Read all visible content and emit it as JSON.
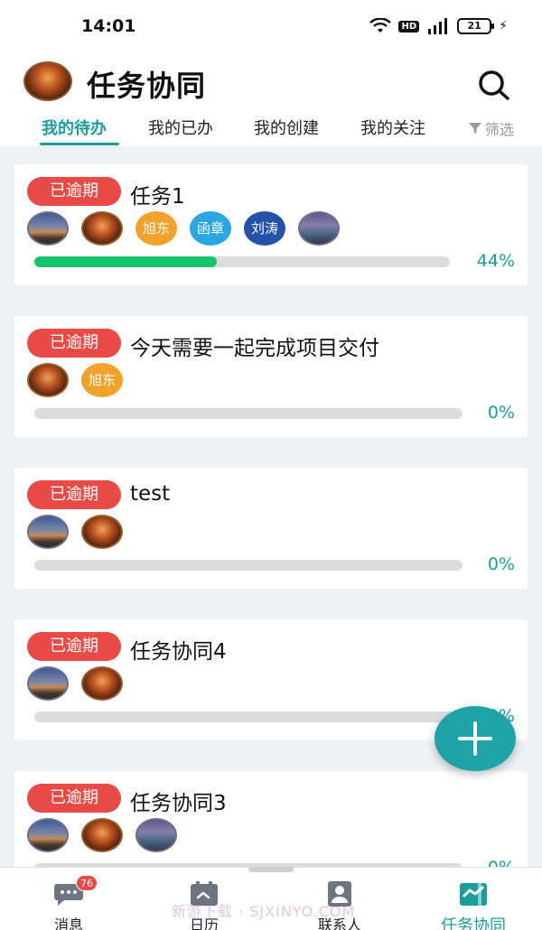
{
  "status_bar": {
    "time": "14:01",
    "hd_label": "HD",
    "battery": "21"
  },
  "header": {
    "title": "任务协同",
    "tabs": [
      {
        "label": "我的待办",
        "active": true
      },
      {
        "label": "我的已办",
        "active": false
      },
      {
        "label": "我的创建",
        "active": false
      },
      {
        "label": "我的关注",
        "active": false
      }
    ],
    "filter_label": "筛选"
  },
  "tasks": [
    {
      "status": "已逾期",
      "title": "任务1",
      "progress_label": "44%",
      "progress": 0.44,
      "assignees": [
        {
          "type": "photo",
          "style": "photo-a"
        },
        {
          "type": "photo",
          "style": "photo-b"
        },
        {
          "type": "text",
          "name": "旭东",
          "color": "#f0a22a"
        },
        {
          "type": "text",
          "name": "函章",
          "color": "#2aa7e0"
        },
        {
          "type": "text",
          "name": "刘涛",
          "color": "#2452a8"
        },
        {
          "type": "photo",
          "style": "photo-c"
        }
      ]
    },
    {
      "status": "已逾期",
      "title": "今天需要一起完成项目交付",
      "progress_label": "0%",
      "progress": 0,
      "assignees": [
        {
          "type": "photo",
          "style": "photo-b"
        },
        {
          "type": "text",
          "name": "旭东",
          "color": "#f0a22a"
        }
      ]
    },
    {
      "status": "已逾期",
      "title": "test",
      "progress_label": "0%",
      "progress": 0,
      "assignees": [
        {
          "type": "photo",
          "style": "photo-a"
        },
        {
          "type": "photo",
          "style": "photo-b"
        }
      ]
    },
    {
      "status": "已逾期",
      "title": "任务协同4",
      "progress_label": "0%",
      "progress": 0,
      "assignees": [
        {
          "type": "photo",
          "style": "photo-a"
        },
        {
          "type": "photo",
          "style": "photo-b"
        }
      ]
    },
    {
      "status": "已逾期",
      "title": "任务协同3",
      "progress_label": "0%",
      "progress": 0,
      "assignees": [
        {
          "type": "photo",
          "style": "photo-a"
        },
        {
          "type": "photo",
          "style": "photo-b"
        },
        {
          "type": "photo",
          "style": "photo-c"
        }
      ]
    }
  ],
  "fab": {
    "icon": "plus-icon"
  },
  "bottom_nav": {
    "items": [
      {
        "label": "消息",
        "icon": "chat-icon",
        "badge": "76",
        "active": false
      },
      {
        "label": "日历",
        "icon": "calendar-icon",
        "active": false
      },
      {
        "label": "联系人",
        "icon": "contacts-icon",
        "active": false
      },
      {
        "label": "任务协同",
        "icon": "task-collab-icon",
        "active": true
      }
    ]
  },
  "watermark": "新游下载 · SJXINYO.COM",
  "colors": {
    "accent": "#1a9e9c",
    "overdue": "#e84a45",
    "progress": "#17c46e"
  }
}
